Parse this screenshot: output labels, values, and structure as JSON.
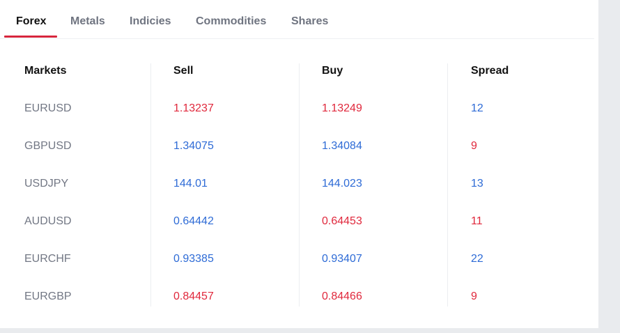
{
  "tabs": [
    {
      "label": "Forex",
      "active": true
    },
    {
      "label": "Metals",
      "active": false
    },
    {
      "label": "Indicies",
      "active": false
    },
    {
      "label": "Commodities",
      "active": false
    },
    {
      "label": "Shares",
      "active": false
    }
  ],
  "table": {
    "headers": {
      "markets": "Markets",
      "sell": "Sell",
      "buy": "Buy",
      "spread": "Spread"
    },
    "rows": [
      {
        "market": "EURUSD",
        "sell": "1.13237",
        "sell_dir": "down",
        "buy": "1.13249",
        "buy_dir": "down",
        "spread": "12",
        "spread_dir": "up"
      },
      {
        "market": "GBPUSD",
        "sell": "1.34075",
        "sell_dir": "up",
        "buy": "1.34084",
        "buy_dir": "up",
        "spread": "9",
        "spread_dir": "down"
      },
      {
        "market": "USDJPY",
        "sell": "144.01",
        "sell_dir": "up",
        "buy": "144.023",
        "buy_dir": "up",
        "spread": "13",
        "spread_dir": "up"
      },
      {
        "market": "AUDUSD",
        "sell": "0.64442",
        "sell_dir": "up",
        "buy": "0.64453",
        "buy_dir": "down",
        "spread": "11",
        "spread_dir": "down"
      },
      {
        "market": "EURCHF",
        "sell": "0.93385",
        "sell_dir": "up",
        "buy": "0.93407",
        "buy_dir": "up",
        "spread": "22",
        "spread_dir": "up"
      },
      {
        "market": "EURGBP",
        "sell": "0.84457",
        "sell_dir": "down",
        "buy": "0.84466",
        "buy_dir": "down",
        "spread": "9",
        "spread_dir": "down"
      }
    ]
  },
  "colors": {
    "up": "#2e6bd6",
    "down": "#e0283c",
    "accent": "#d7263d",
    "page_background": "#e9ebee"
  }
}
